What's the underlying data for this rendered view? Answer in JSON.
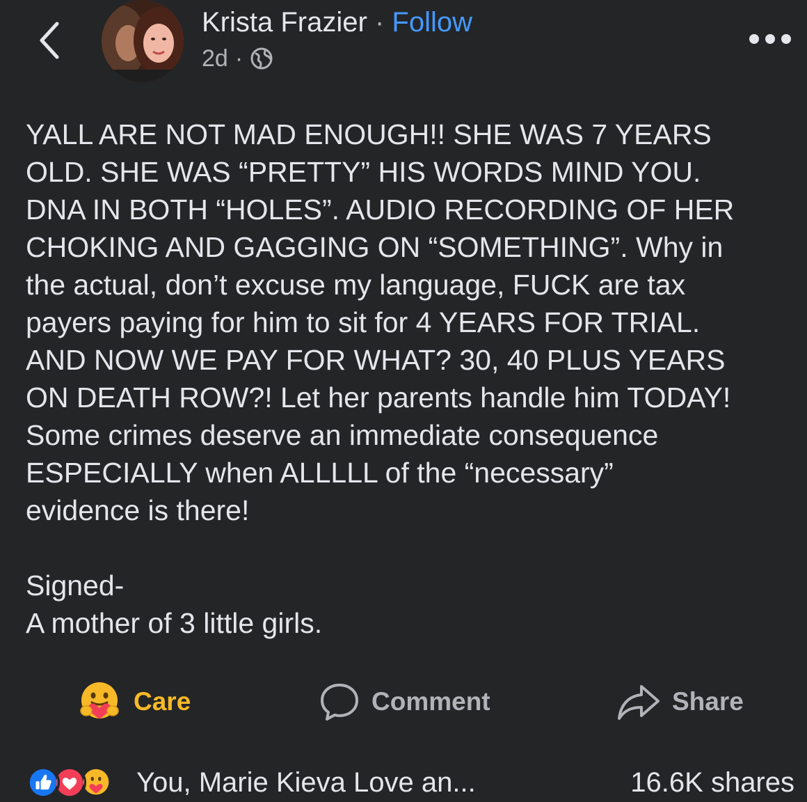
{
  "header": {
    "author_name": "Krista Frazier",
    "separator": "·",
    "follow_label": "Follow",
    "timestamp": "2d",
    "meta_separator": "·",
    "privacy_icon": "globe-icon",
    "back_icon": "chevron-left-icon",
    "more_icon": "more-horizontal-icon"
  },
  "post": {
    "text": "YALL ARE NOT MAD ENOUGH!! SHE WAS 7 YEARS\nOLD. SHE WAS “PRETTY” HIS WORDS MIND YOU.\nDNA IN BOTH “HOLES”. AUDIO RECORDING OF HER\nCHOKING AND GAGGING ON “SOMETHING”. Why in\nthe actual, don’t excuse my language, FUCK are tax\npayers paying for him to sit for 4 YEARS FOR TRIAL.\nAND NOW WE PAY FOR WHAT? 30, 40 PLUS YEARS\nON DEATH ROW?! Let her parents handle him TODAY!\nSome crimes deserve an immediate consequence\nESPECIALLY when ALLLLL of the “necessary”\nevidence is there!\n\nSigned-\nA mother of 3 little girls."
  },
  "actions": {
    "care_label": "Care",
    "care_icon": "care-emoji-icon",
    "comment_label": "Comment",
    "comment_icon": "comment-bubble-icon",
    "share_label": "Share",
    "share_icon": "share-arrow-icon"
  },
  "footer": {
    "reaction_icons": [
      "like-icon",
      "love-icon",
      "care-icon"
    ],
    "reactors_text": "You, Marie Kieva Love an...",
    "shares_text": "16.6K shares"
  },
  "colors": {
    "background": "#242526",
    "text": "#e4e6eb",
    "secondary": "#b0b3b8",
    "follow": "#4599ff",
    "care": "#f7b928",
    "like": "#1877f2",
    "love": "#f33e58"
  }
}
